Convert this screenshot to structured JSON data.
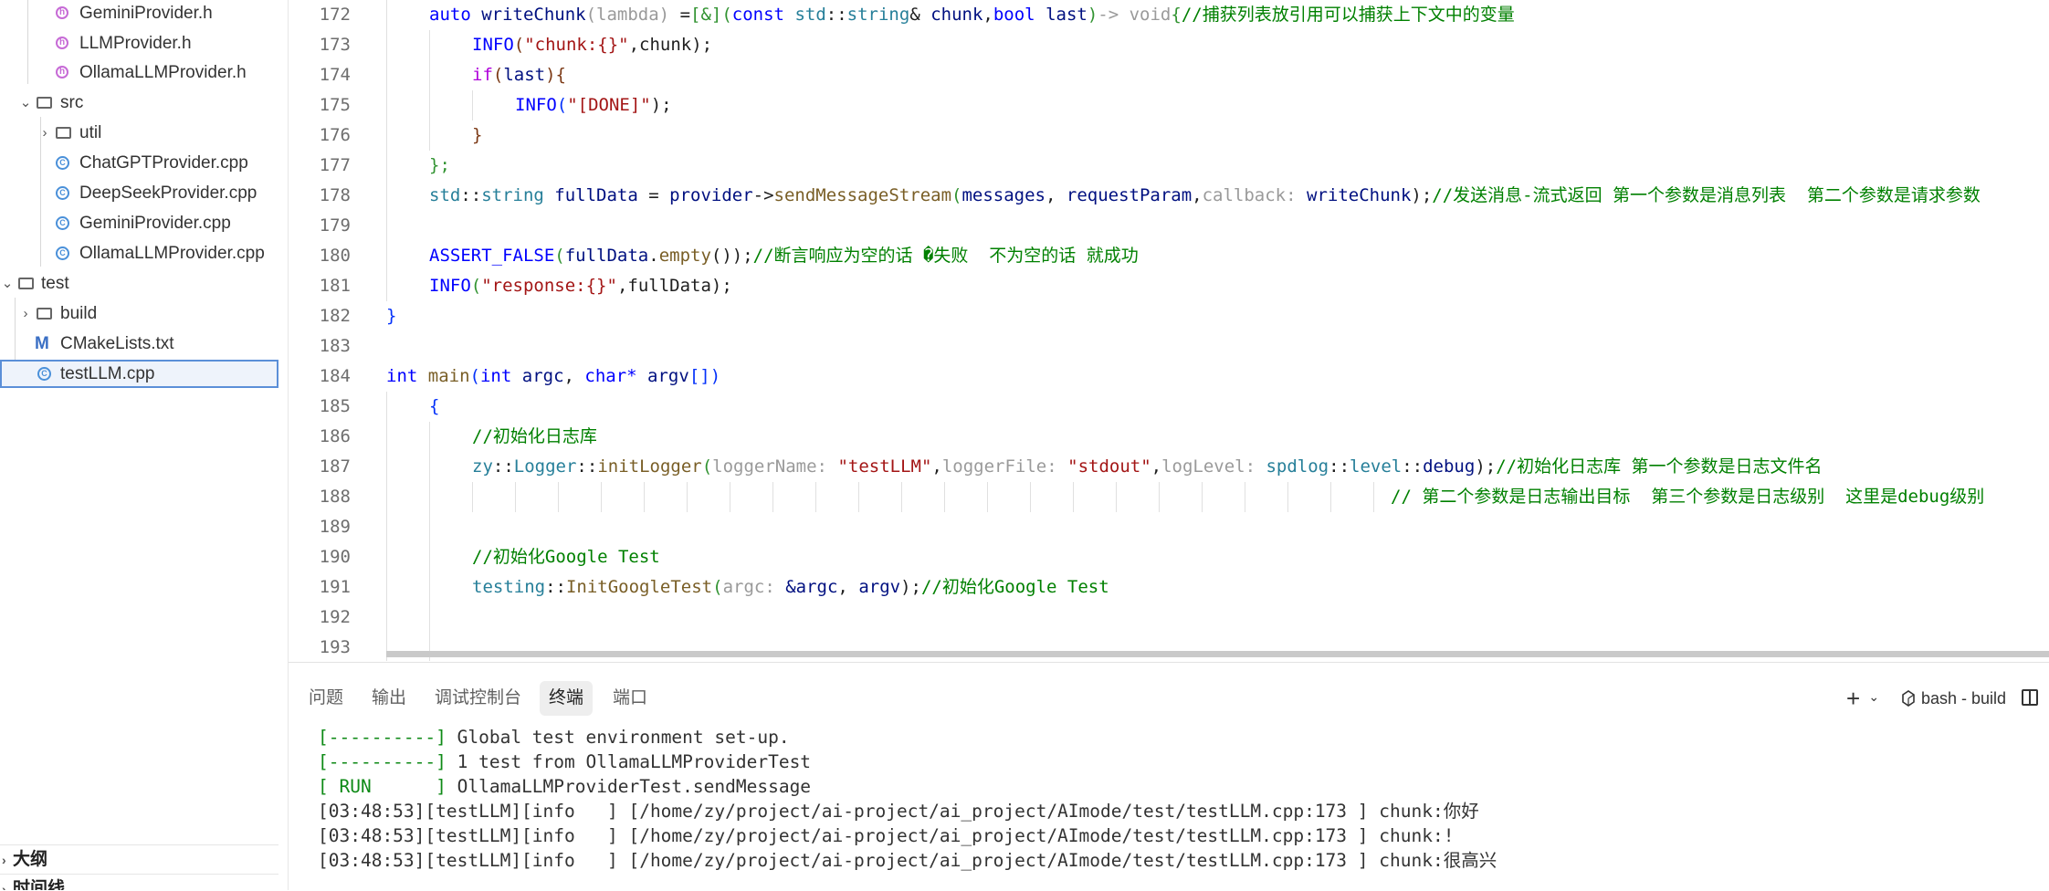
{
  "explorer": {
    "items": [
      {
        "label": "GeminiProvider.h",
        "kind": "h"
      },
      {
        "label": "LLMProvider.h",
        "kind": "h"
      },
      {
        "label": "OllamaLLMProvider.h",
        "kind": "h"
      },
      {
        "label": "src",
        "kind": "folder-open"
      },
      {
        "label": "util",
        "kind": "folder"
      },
      {
        "label": "ChatGPTProvider.cpp",
        "kind": "cpp"
      },
      {
        "label": "DeepSeekProvider.cpp",
        "kind": "cpp"
      },
      {
        "label": "GeminiProvider.cpp",
        "kind": "cpp"
      },
      {
        "label": "OllamaLLMProvider.cpp",
        "kind": "cpp"
      },
      {
        "label": "test",
        "kind": "folder-open"
      },
      {
        "label": "build",
        "kind": "folder"
      },
      {
        "label": "CMakeLists.txt",
        "kind": "cmake"
      },
      {
        "label": "testLLM.cpp",
        "kind": "cpp"
      }
    ],
    "outline_label": "大纲",
    "timeline_label": "时间线"
  },
  "editor": {
    "line_numbers": [
      "172",
      "173",
      "174",
      "175",
      "176",
      "177",
      "178",
      "179",
      "180",
      "181",
      "182",
      "183",
      "184",
      "185",
      "186",
      "187",
      "188",
      "189",
      "190",
      "191",
      "192",
      "193"
    ],
    "l172": {
      "a": "auto",
      "b": "writeChunk",
      "c": "(lambda)",
      "d": "=",
      "e": "[&](",
      "f": "const",
      "g": "std",
      "h": "::",
      "i": "string",
      "j": "& ",
      "k": "chunk",
      "l": ",",
      "m": "bool",
      "n": " last",
      "o": ")",
      "p": "-> void",
      "q": "{",
      "r": "//捕获列表放引用可以捕获上下文中的变量"
    },
    "l173": {
      "a": "INFO",
      "b": "(",
      "c": "\"chunk:{}\"",
      "d": ",chunk);"
    },
    "l174": {
      "a": "if",
      "b": "(",
      "c": "last",
      "d": "){"
    },
    "l175": {
      "a": "INFO",
      "b": "(",
      "c": "\"[DONE]\"",
      "d": ");"
    },
    "l176": {
      "a": "}"
    },
    "l177": {
      "a": "};"
    },
    "l178": {
      "a": "std",
      "b": "::",
      "c": "string",
      "d": " fullData",
      "e": " = ",
      "f": "provider",
      "g": "->",
      "h": "sendMessageStream",
      "i": "(",
      "j": "messages",
      "k": ", ",
      "l": "requestParam",
      "m": ",",
      "n": "callback:",
      "o": " writeChunk",
      "p": ");",
      "q": "//发送消息-流式返回 第一个参数是消息列表  第二个参数是请求参数"
    },
    "l180": {
      "a": "ASSERT_FALSE",
      "b": "(",
      "c": "fullData",
      "d": ".",
      "e": "empty",
      "f": "());",
      "g": "//断言响应为空的话 �失败  不为空的话 就成功"
    },
    "l181": {
      "a": "INFO",
      "b": "(",
      "c": "\"response:{}\"",
      "d": ",fullData);"
    },
    "l182": {
      "a": "}"
    },
    "l184": {
      "a": "int",
      "b": " main",
      "c": "(",
      "d": "int",
      "e": " argc",
      "f": ", ",
      "g": "char*",
      "h": " argv",
      "i": "[])"
    },
    "l185": {
      "a": "{"
    },
    "l186": {
      "a": "//初始化日志库"
    },
    "l187": {
      "a": "zy",
      "b": "::",
      "c": "Logger",
      "d": "::",
      "e": "initLogger",
      "f": "(",
      "g": "loggerName:",
      "h": " \"testLLM\"",
      "i": ",",
      "j": "loggerFile:",
      "k": " \"stdout\"",
      "l": ",",
      "m": "logLevel:",
      "n": " spdlog",
      "o": "::",
      "p": "level",
      "q": "::",
      "r": "debug",
      "s": ");",
      "t": "//初始化日志库 第一个参数是日志文件名"
    },
    "l188": {
      "a": "// 第二个参数是日志输出目标  第三个参数是日志级别  这里是debug级别"
    },
    "l190": {
      "a": "//初始化Google Test"
    },
    "l191": {
      "a": "testing",
      "b": "::",
      "c": "InitGoogleTest",
      "d": "(",
      "e": "argc:",
      "f": " &argc",
      "g": ", ",
      "h": "argv",
      "i": ");",
      "j": "//初始化Google Test"
    }
  },
  "panel": {
    "tabs": [
      "问题",
      "输出",
      "调试控制台",
      "终端",
      "端口"
    ],
    "active_tab": "终端",
    "add_label": "+",
    "dropdown_glyph": "⌄",
    "terminal_name": "bash - build",
    "lines": [
      {
        "tag": "[----------]",
        "text": " Global test environment set-up."
      },
      {
        "tag": "[----------]",
        "text": " 1 test from OllamaLLMProviderTest"
      },
      {
        "tag": "[ RUN      ]",
        "text": " OllamaLLMProviderTest.sendMessage"
      },
      {
        "tag": "",
        "text": "[03:48:53][testLLM][info   ] [/home/zy/project/ai-project/ai_project/AImode/test/testLLM.cpp:173 ] chunk:你好"
      },
      {
        "tag": "",
        "text": "[03:48:53][testLLM][info   ] [/home/zy/project/ai-project/ai_project/AImode/test/testLLM.cpp:173 ] chunk:!"
      },
      {
        "tag": "",
        "text": "[03:48:53][testLLM][info   ] [/home/zy/project/ai-project/ai_project/AImode/test/testLLM.cpp:173 ] chunk:很高兴"
      }
    ]
  }
}
